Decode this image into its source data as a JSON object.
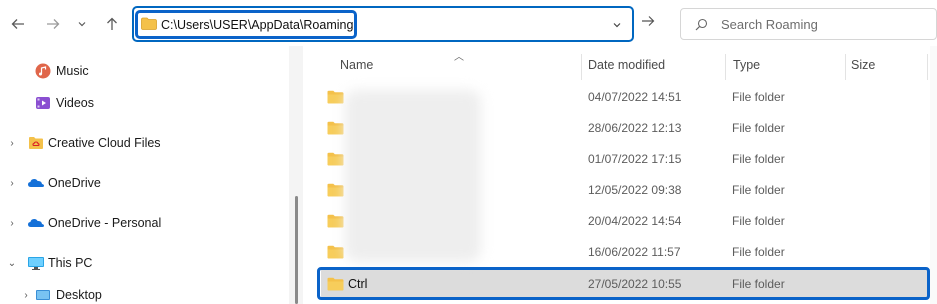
{
  "toolbar": {
    "back_icon": "back-arrow-icon",
    "forward_icon": "forward-arrow-icon",
    "recent_icon": "chevron-down-icon",
    "up_icon": "up-arrow-icon",
    "address": "C:\\Users\\USER\\AppData\\Roaming",
    "refresh_icon": "arrow-right-icon",
    "search_placeholder": "Search Roaming"
  },
  "nav": {
    "items": [
      {
        "label": "Music",
        "icon": "music-icon",
        "expander": ""
      },
      {
        "label": "Videos",
        "icon": "videos-icon",
        "expander": ""
      },
      {
        "label": "Creative Cloud Files",
        "icon": "creative-cloud-icon",
        "expander": "›"
      },
      {
        "label": "OneDrive",
        "icon": "onedrive-cloud-icon",
        "expander": "›"
      },
      {
        "label": "OneDrive - Personal",
        "icon": "onedrive-cloud-icon",
        "expander": "›"
      },
      {
        "label": "This PC",
        "icon": "this-pc-icon",
        "expander": "⌄"
      },
      {
        "label": "Desktop",
        "icon": "desktop-icon",
        "expander": "›"
      }
    ]
  },
  "list": {
    "columns": {
      "name": "Name",
      "date": "Date modified",
      "type": "Type",
      "size": "Size"
    },
    "rows": [
      {
        "name": "",
        "date": "04/07/2022 14:51",
        "type": "File folder"
      },
      {
        "name": "",
        "date": "28/06/2022 12:13",
        "type": "File folder"
      },
      {
        "name": "",
        "date": "01/07/2022 17:15",
        "type": "File folder"
      },
      {
        "name": "",
        "date": "12/05/2022 09:38",
        "type": "File folder"
      },
      {
        "name": "",
        "date": "20/04/2022 14:54",
        "type": "File folder"
      },
      {
        "name": "",
        "date": "16/06/2022 11:57",
        "type": "File folder"
      },
      {
        "name": "Ctrl",
        "date": "27/05/2022 10:55",
        "type": "File folder",
        "selected": true
      }
    ]
  },
  "colors": {
    "accent": "#0067c0",
    "highlight": "#0a63c9",
    "folder": "#f4c14a",
    "selected_row": "#dcdcdc"
  }
}
